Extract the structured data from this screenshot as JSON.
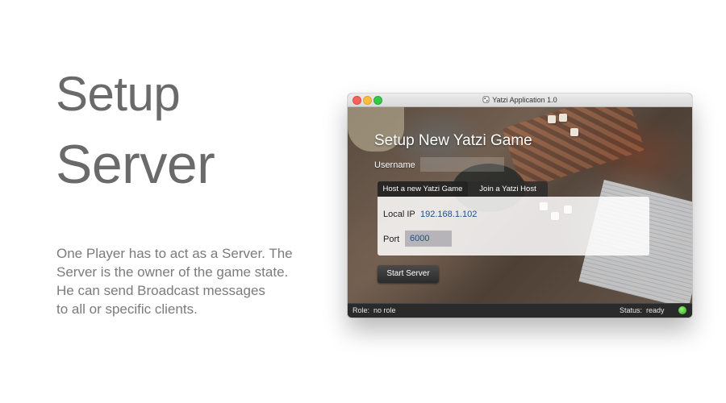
{
  "intro": {
    "heading_line1": "Setup",
    "heading_line2": "Server",
    "description_lines": [
      "One Player has to act as a Server. The",
      "Server is the owner of the game state.",
      "He can send Broadcast messages",
      "to all or specific clients."
    ]
  },
  "window": {
    "title": "Yatzi Application 1.0",
    "traffic_lights": {
      "close_color": "#fc605b",
      "minimize_color": "#fdbc40",
      "zoom_color": "#34c84a"
    }
  },
  "form": {
    "title": "Setup New Yatzi Game",
    "username_label": "Username",
    "username_value": "",
    "tabs": [
      {
        "label": "Host a new Yatzi Game",
        "selected": true
      },
      {
        "label": "Join a Yatzi Host",
        "selected": false
      }
    ],
    "host_panel": {
      "local_ip_label": "Local IP",
      "local_ip_value": "192.168.1.102",
      "port_label": "Port",
      "port_value": "6000"
    },
    "start_button": "Start Server"
  },
  "statusbar": {
    "role_label": "Role:",
    "role_value": "no role",
    "status_label": "Status:",
    "status_value": "ready",
    "status_color": "#3aa327"
  },
  "colors": {
    "accent_value": "#1f4f8a",
    "heading": "#6a6a6a"
  }
}
